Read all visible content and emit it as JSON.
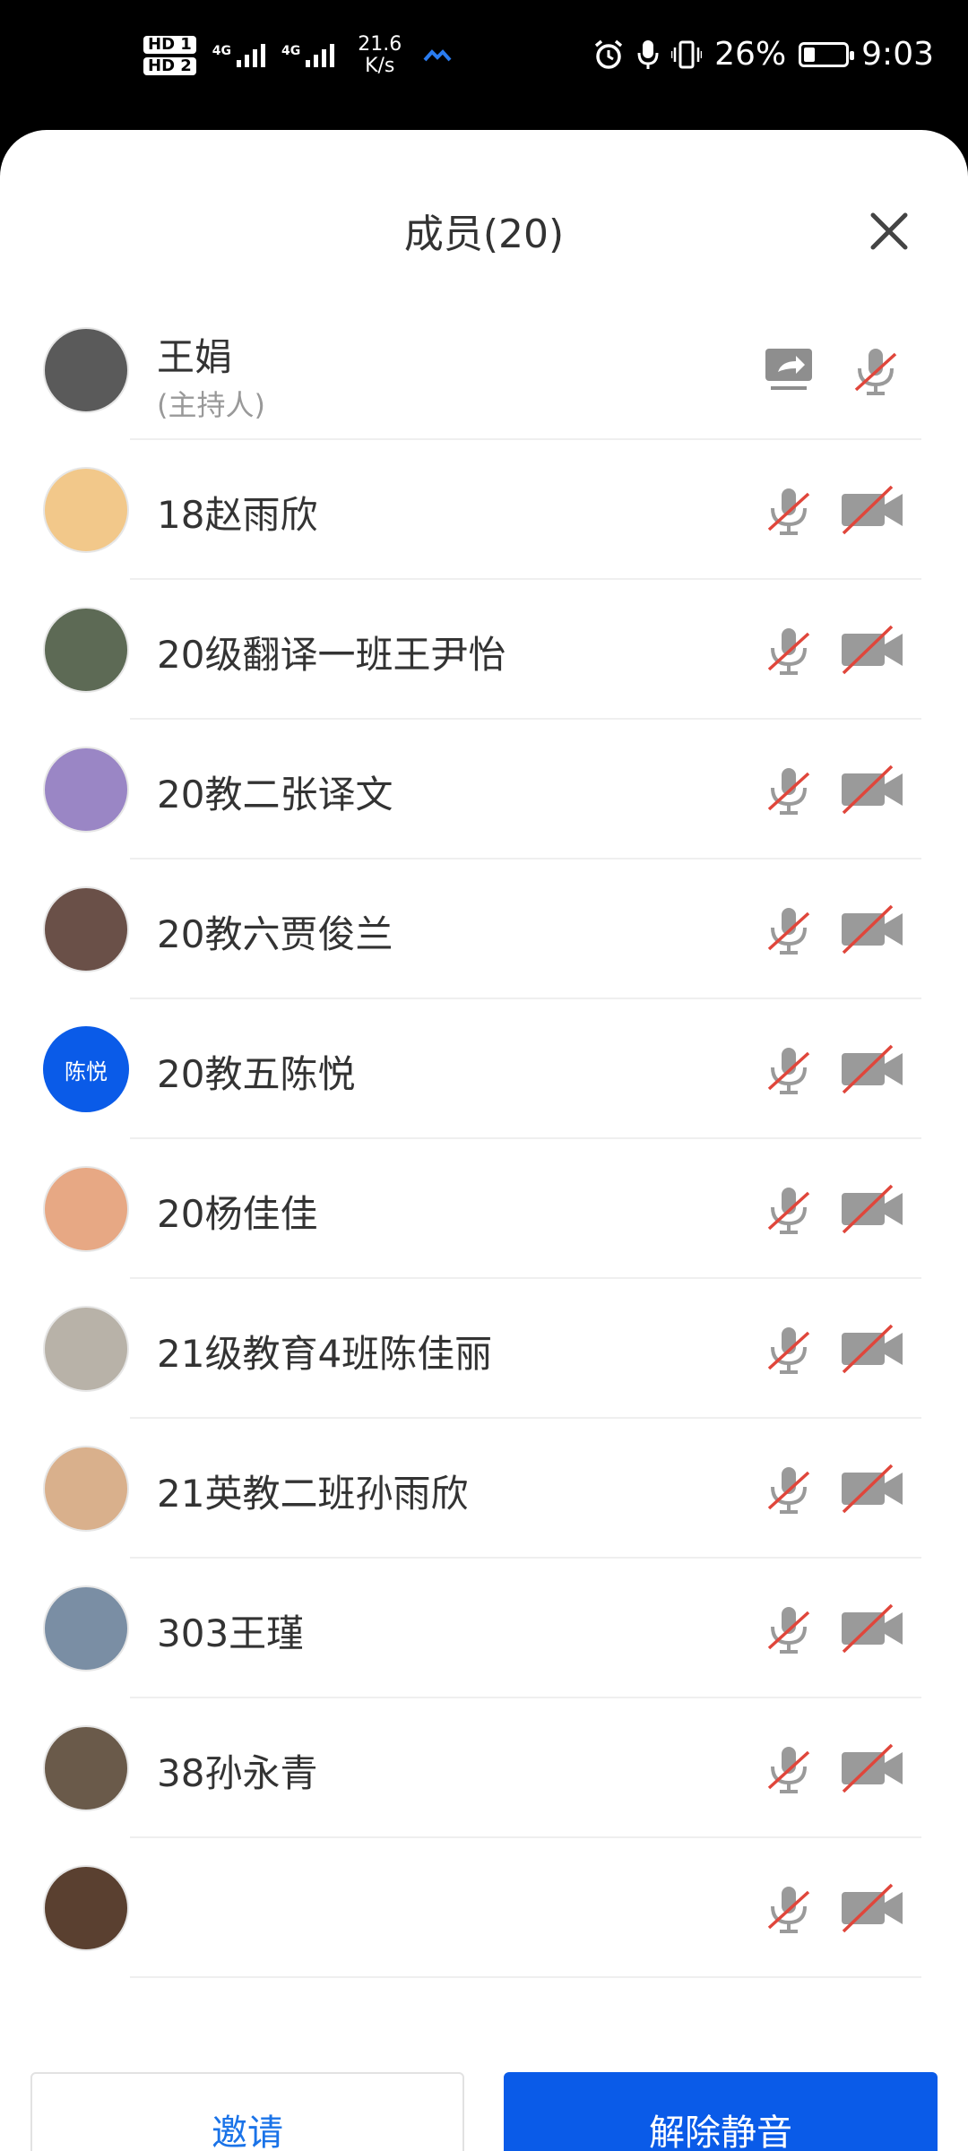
{
  "status_bar": {
    "hd1": "HD 1",
    "hd2": "HD 2",
    "net1": "4G",
    "net2": "4G",
    "speed_value": "21.6",
    "speed_unit": "K/s",
    "battery": "26%",
    "time": "9:03"
  },
  "header": {
    "title": "成员(20)"
  },
  "members": [
    {
      "name": "王娟",
      "role": "(主持人)",
      "avatar_color": "#5a5a5a"
    },
    {
      "name": "18赵雨欣",
      "avatar_color": "#f2c88a"
    },
    {
      "name": "20级翻译一班王尹怡",
      "avatar_color": "#5d6a55"
    },
    {
      "name": "20教二张译文",
      "avatar_color": "#9a86c5"
    },
    {
      "name": "20教六贾俊兰",
      "avatar_color": "#6a5048"
    },
    {
      "name": "20教五陈悦",
      "avatar_text": "陈悦",
      "avatar_color": "#0a5be8"
    },
    {
      "name": "20杨佳佳",
      "avatar_color": "#e7a884"
    },
    {
      "name": "21级教育4班陈佳丽",
      "avatar_color": "#b8b2a8"
    },
    {
      "name": "21英教二班孙雨欣",
      "avatar_color": "#d9b08c"
    },
    {
      "name": "303王瑾",
      "avatar_color": "#7a8ea4"
    },
    {
      "name": "38孙永青",
      "avatar_color": "#6a5a4a"
    },
    {
      "name": "",
      "avatar_color": "#5a4030"
    }
  ],
  "buttons": {
    "invite": "邀请",
    "unmute": "解除静音"
  },
  "colors": {
    "accent": "#0a5be8",
    "muted_slash": "#e0463b"
  }
}
